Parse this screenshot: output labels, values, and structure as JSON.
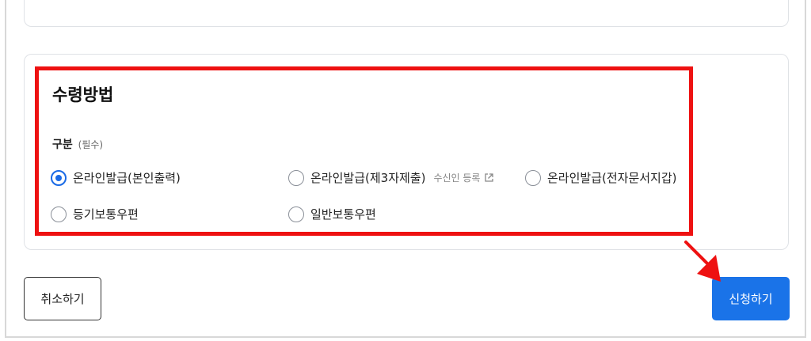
{
  "section": {
    "title": "수령방법",
    "field_label": "구분",
    "required_tag": "(필수)",
    "options": [
      {
        "label": "온라인발급(본인출력)",
        "checked": true
      },
      {
        "label": "온라인발급(제3자제출)",
        "checked": false,
        "link_label": "수신인 등록"
      },
      {
        "label": "온라인발급(전자문서지갑)",
        "checked": false
      },
      {
        "label": "등기보통우편",
        "checked": false
      },
      {
        "label": "일반보통우편",
        "checked": false
      }
    ]
  },
  "actions": {
    "cancel_label": "취소하기",
    "submit_label": "신청하기"
  },
  "colors": {
    "accent": "#1a73e8",
    "highlight": "#ee1111"
  }
}
